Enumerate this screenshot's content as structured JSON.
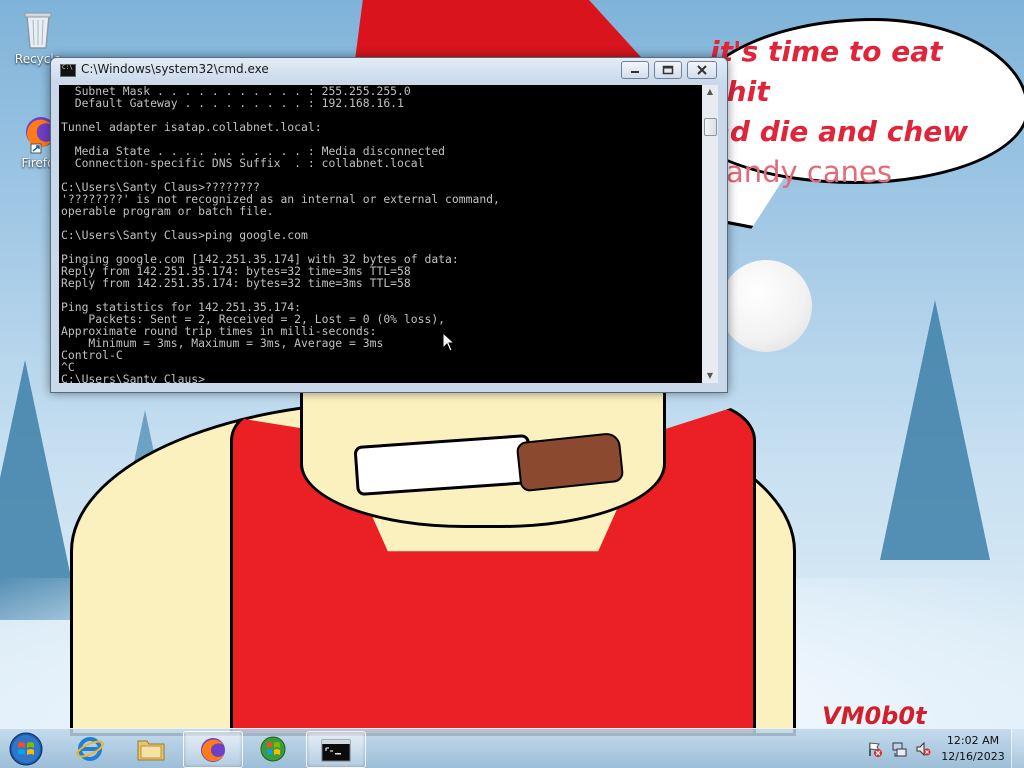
{
  "desktop": {
    "icons": [
      {
        "label": "Recycle",
        "icon": "recycle-bin-icon"
      },
      {
        "label": "Firefo",
        "icon": "firefox-icon"
      }
    ],
    "wallpaper": {
      "speech_lines": [
        "it's time to eat shit",
        "nd die and chew",
        "candy canes"
      ],
      "signature": "VM0b0t"
    }
  },
  "cmd_window": {
    "title": "C:\\Windows\\system32\\cmd.exe",
    "output": "  Subnet Mask . . . . . . . . . . . : 255.255.255.0\n  Default Gateway . . . . . . . . . : 192.168.16.1\n\nTunnel adapter isatap.collabnet.local:\n\n  Media State . . . . . . . . . . . : Media disconnected\n  Connection-specific DNS Suffix  . : collabnet.local\n\nC:\\Users\\Santy Claus>????????\n'????????' is not recognized as an internal or external command,\noperable program or batch file.\n\nC:\\Users\\Santy Claus>ping google.com\n\nPinging google.com [142.251.35.174] with 32 bytes of data:\nReply from 142.251.35.174: bytes=32 time=3ms TTL=58\nReply from 142.251.35.174: bytes=32 time=3ms TTL=58\n\nPing statistics for 142.251.35.174:\n    Packets: Sent = 2, Received = 2, Lost = 0 (0% loss),\nApproximate round trip times in milli-seconds:\n    Minimum = 3ms, Maximum = 3ms, Average = 3ms\nControl-C\n^C\nC:\\Users\\Santy Claus>",
    "buttons": {
      "minimize": "minimize",
      "maximize": "maximize",
      "close": "close"
    },
    "console_colors": {
      "background": "#000000",
      "text": "#c0c0c0"
    }
  },
  "taskbar": {
    "start": "start-orb-icon",
    "items": [
      {
        "name": "internet-explorer",
        "icon": "internet-explorer-icon",
        "active": false
      },
      {
        "name": "file-explorer",
        "icon": "folder-icon",
        "active": false
      },
      {
        "name": "firefox",
        "icon": "firefox-icon",
        "active": true
      },
      {
        "name": "media-player",
        "icon": "windows-media-icon",
        "active": false
      },
      {
        "name": "command-prompt",
        "icon": "cmd-icon",
        "active": true
      }
    ],
    "tray": {
      "icons": [
        "action-center-flag-icon",
        "network-icon",
        "volume-muted-icon"
      ],
      "time": "12:02 AM",
      "date": "12/16/2023"
    }
  }
}
